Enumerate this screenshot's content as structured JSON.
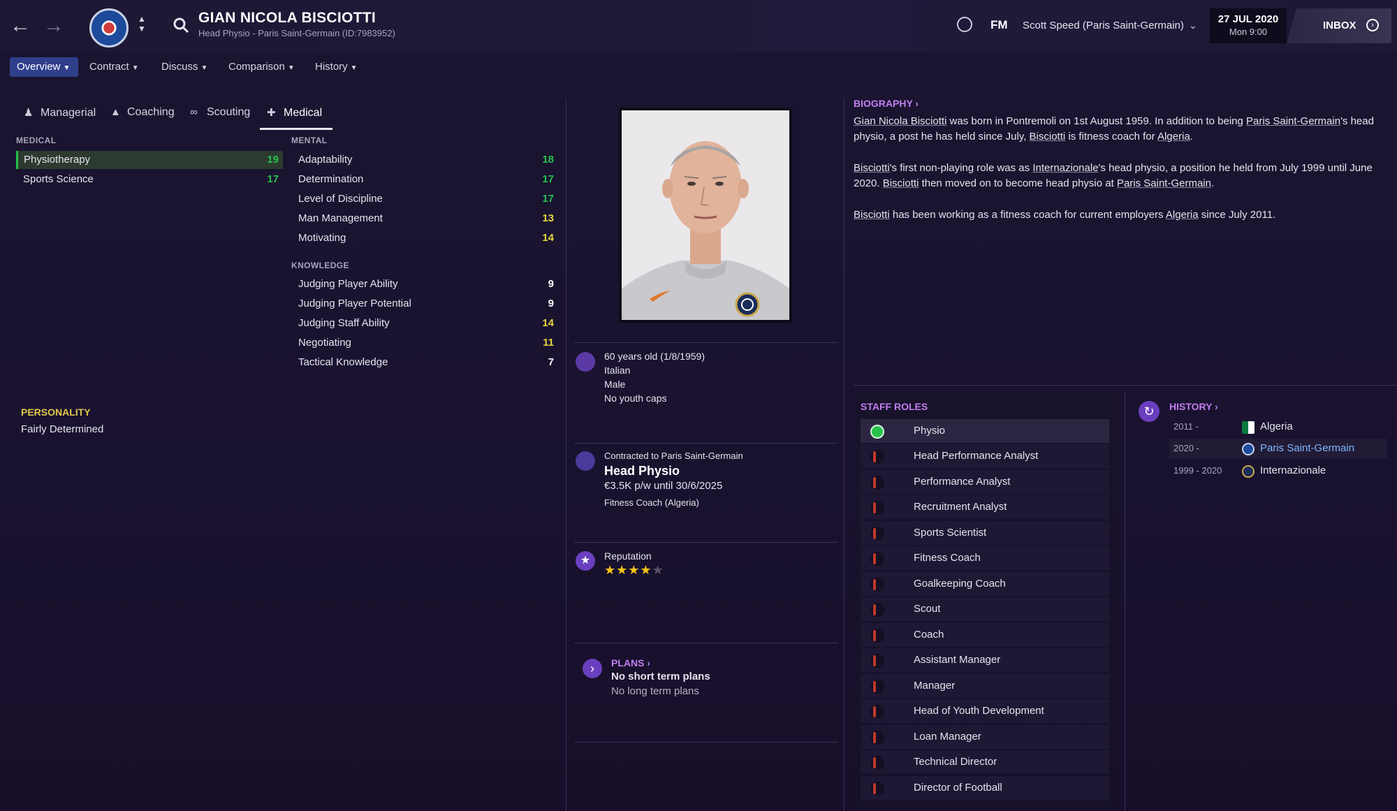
{
  "header": {
    "title": "GIAN NICOLA BISCIOTTI",
    "subtitle": "Head Physio - Paris Saint-Germain (ID:7983952)",
    "fm_logo": "FM",
    "manager": "Scott Speed (Paris Saint-Germain)",
    "date": "27 JUL 2020",
    "time": "Mon 9:00",
    "inbox": "INBOX",
    "accent_color": "#2f3f8c"
  },
  "menu": [
    "Overview",
    "Contract",
    "Discuss",
    "Comparison",
    "History"
  ],
  "tabs": [
    "Managerial",
    "Coaching",
    "Scouting",
    "Medical"
  ],
  "medical": {
    "title": "MEDICAL",
    "items": [
      {
        "label": "Physiotherapy",
        "value": "19"
      },
      {
        "label": "Sports Science",
        "value": "17"
      }
    ]
  },
  "mental": {
    "title": "MENTAL",
    "items": [
      {
        "label": "Adaptability",
        "value": "18"
      },
      {
        "label": "Determination",
        "value": "17"
      },
      {
        "label": "Level of Discipline",
        "value": "17"
      },
      {
        "label": "Man Management",
        "value": "13"
      },
      {
        "label": "Motivating",
        "value": "14"
      }
    ]
  },
  "knowledge": {
    "title": "KNOWLEDGE",
    "items": [
      {
        "label": "Judging Player Ability",
        "value": "9"
      },
      {
        "label": "Judging Player Potential",
        "value": "9"
      },
      {
        "label": "Judging Staff Ability",
        "value": "14"
      },
      {
        "label": "Negotiating",
        "value": "11"
      },
      {
        "label": "Tactical Knowledge",
        "value": "7"
      }
    ]
  },
  "personality": {
    "title": "PERSONALITY",
    "value": "Fairly Determined"
  },
  "profile": {
    "age": "60 years old (1/8/1959)",
    "nationality": "Italian",
    "gender": "Male",
    "youth_caps": "No youth caps"
  },
  "contract": {
    "contracted_to": "Contracted to Paris Saint-Germain",
    "role": "Head Physio",
    "wage": "€3.5K p/w until 30/6/2025",
    "second_job": "Fitness Coach (Algeria)"
  },
  "reputation": {
    "label": "Reputation",
    "stars": 4,
    "max": 5
  },
  "plans": {
    "title": "PLANS",
    "short": "No short term plans",
    "long": "No long term plans"
  },
  "biography": {
    "title": "BIOGRAPHY",
    "p1": {
      "a": "Gian Nicola Bisciotti",
      "b": " was born in Pontremoli on 1st August 1959. In addition to being ",
      "c": "Paris Saint-Germain",
      "d": "'s head physio, a post he has held since July, ",
      "e": "Bisciotti",
      "f": " is fitness coach for ",
      "g": "Algeria",
      "h": "."
    },
    "p2": {
      "a": "Bisciotti",
      "b": "'s first non-playing role was as ",
      "c": "Internazionale",
      "d": "'s head physio, a position he held from July 1999 until June 2020. ",
      "e": "Bisciotti",
      "f": " then moved on to become head physio at ",
      "g": "Paris Saint-Germain",
      "h": "."
    },
    "p3": {
      "a": "Bisciotti",
      "b": " has been working as a fitness coach for current employers ",
      "c": "Algeria",
      "d": " since July 2011."
    }
  },
  "staff_roles": {
    "title": "STAFF ROLES",
    "items": [
      "Physio",
      "Head Performance Analyst",
      "Performance Analyst",
      "Recruitment Analyst",
      "Sports Scientist",
      "Fitness Coach",
      "Goalkeeping Coach",
      "Scout",
      "Coach",
      "Assistant Manager",
      "Manager",
      "Head of Youth Development",
      "Loan Manager",
      "Technical Director",
      "Director of Football"
    ]
  },
  "history": {
    "title": "HISTORY",
    "items": [
      {
        "years": "2011 -",
        "club": "Algeria"
      },
      {
        "years": "2020 -",
        "club": "Paris Saint-Germain"
      },
      {
        "years": "1999 - 2020",
        "club": "Internazionale"
      }
    ]
  }
}
